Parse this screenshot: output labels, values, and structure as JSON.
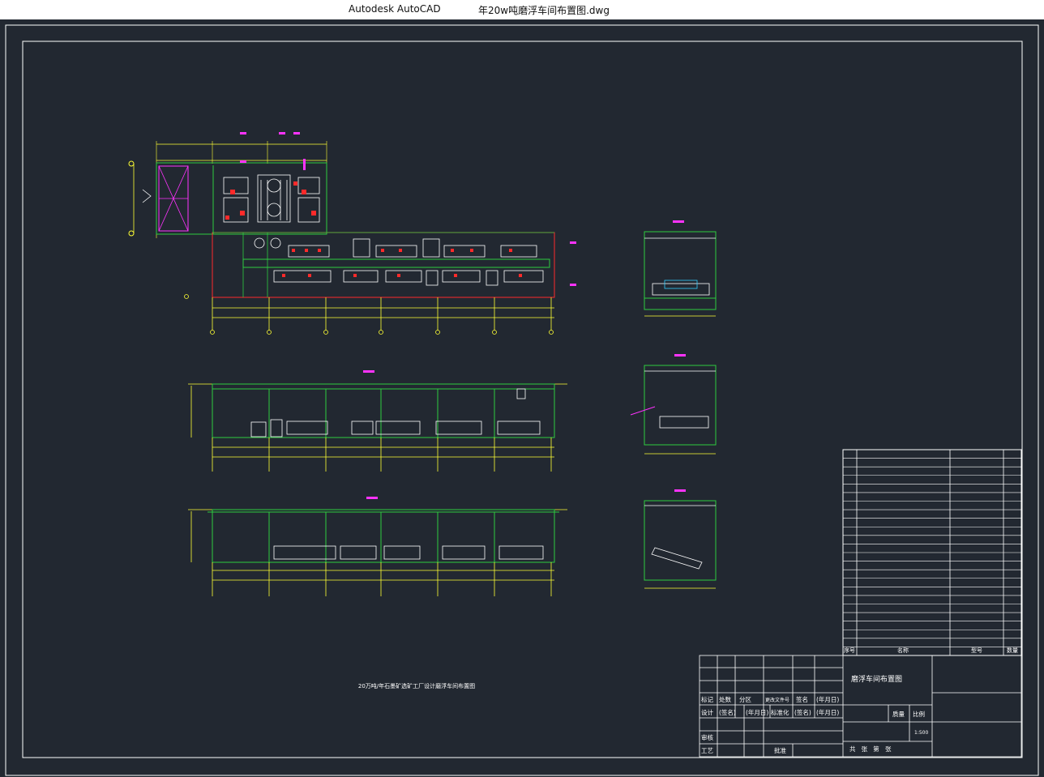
{
  "window": {
    "app_title": "Autodesk AutoCAD",
    "file_title": "年20w吨磨浮车间布置图.dwg"
  },
  "drawing": {
    "caption": "20万吨/年石墨矿选矿工厂设计磨浮车间布置图",
    "colors": {
      "background": "#222831",
      "frame": "#ffffff",
      "structure": "#2ecc40",
      "dimension": "#ffff33",
      "equipment": "#ffffff",
      "marker": "#ff33ff",
      "red": "#ff2a2a",
      "cyan": "#33ccff"
    }
  },
  "parts_list": {
    "header": {
      "no": "序号",
      "name": "名称",
      "model": "型号",
      "qty": "数量"
    },
    "row_count": 24
  },
  "title_block": {
    "drawing_name": "磨浮车间布置图",
    "row1": [
      "标记",
      "处数",
      "分区",
      "更改文件号",
      "签名",
      "(年月日)"
    ],
    "row2": [
      "设计",
      "(签名)",
      "(年月日)",
      "标准化",
      "(签名)",
      "(年月日)"
    ],
    "review": "审核",
    "process": "工艺",
    "approve": "批准",
    "weight": "质量",
    "scale_label": "比例",
    "scale_value": "1:500",
    "sheets": "共   张   第   张"
  }
}
